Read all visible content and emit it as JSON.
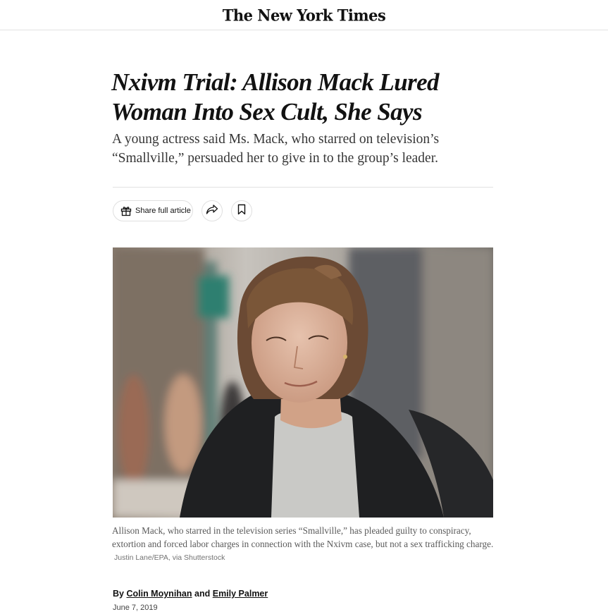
{
  "masthead": {
    "title": "The New York Times"
  },
  "article": {
    "headline_line1": "Nxivm Trial: Allison Mack Lured",
    "headline_line2": "Woman Into Sex Cult, She Says",
    "summary": "A young actress said Ms. Mack, who starred on television’s “Smallville,” persuaded her to give in to the group’s leader."
  },
  "toolbar": {
    "share_full_label": "Share full article",
    "gift_icon": "gift-icon",
    "share_icon": "share-arrow-icon",
    "save_icon": "bookmark-icon"
  },
  "photo": {
    "caption": "Allison Mack, who starred in the television series “Smallville,” has pleaded guilty to conspiracy, extortion and forced labor charges in connection with the Nxivm case, but not a sex trafficking charge.",
    "credit": "Justin Lane/EPA, via Shutterstock"
  },
  "byline": {
    "prefix": "By",
    "author1": "Colin Moynihan",
    "and": "and",
    "author2": "Emily Palmer"
  },
  "dateline": "June 7, 2019"
}
